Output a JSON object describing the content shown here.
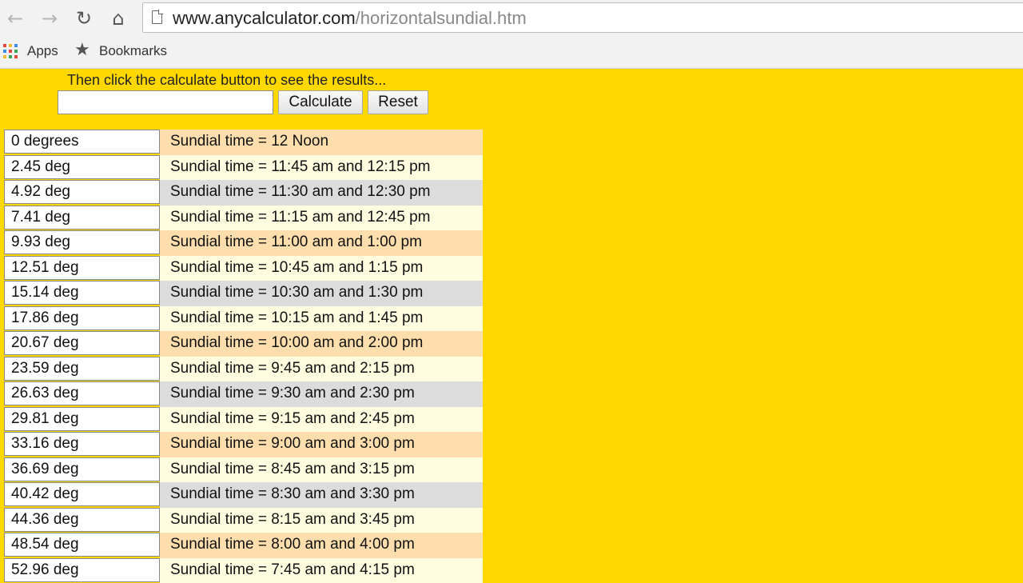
{
  "browser": {
    "url_domain": "www.anycalculator.com",
    "url_path": "/horizontalsundial.htm",
    "bookmarks": {
      "apps_label": "Apps",
      "bookmarks_label": "Bookmarks"
    }
  },
  "form": {
    "instruction": "Then click the calculate button to see the results...",
    "input_value": "",
    "calculate_label": "Calculate",
    "reset_label": "Reset"
  },
  "colors": {
    "page_background": "#ffd800",
    "row_peach": "#ffdead",
    "row_cream": "#fffde0",
    "row_gray": "#dcdcdc"
  },
  "table": {
    "rows": [
      {
        "deg": "0 degrees",
        "time": "Sundial time = 12 Noon",
        "shade": "peach"
      },
      {
        "deg": "2.45 deg",
        "time": "Sundial time = 11:45 am and 12:15 pm",
        "shade": "cream"
      },
      {
        "deg": "4.92 deg",
        "time": "Sundial time = 11:30 am and 12:30 pm",
        "shade": "gray"
      },
      {
        "deg": "7.41 deg",
        "time": "Sundial time = 11:15 am and 12:45 pm",
        "shade": "cream"
      },
      {
        "deg": "9.93 deg",
        "time": "Sundial time = 11:00 am and 1:00 pm",
        "shade": "peach"
      },
      {
        "deg": "12.51 deg",
        "time": "Sundial time = 10:45 am and 1:15 pm",
        "shade": "cream"
      },
      {
        "deg": "15.14 deg",
        "time": "Sundial time = 10:30 am and 1:30 pm",
        "shade": "gray"
      },
      {
        "deg": "17.86 deg",
        "time": "Sundial time = 10:15 am and 1:45 pm",
        "shade": "cream"
      },
      {
        "deg": "20.67 deg",
        "time": "Sundial time = 10:00 am and 2:00 pm",
        "shade": "peach"
      },
      {
        "deg": "23.59 deg",
        "time": "Sundial time = 9:45 am and 2:15 pm",
        "shade": "cream"
      },
      {
        "deg": "26.63 deg",
        "time": "Sundial time = 9:30 am and 2:30 pm",
        "shade": "gray"
      },
      {
        "deg": "29.81 deg",
        "time": "Sundial time = 9:15 am and 2:45 pm",
        "shade": "cream"
      },
      {
        "deg": "33.16 deg",
        "time": "Sundial time = 9:00 am and 3:00 pm",
        "shade": "peach"
      },
      {
        "deg": "36.69 deg",
        "time": "Sundial time = 8:45 am and 3:15 pm",
        "shade": "cream"
      },
      {
        "deg": "40.42 deg",
        "time": "Sundial time = 8:30 am and 3:30 pm",
        "shade": "gray"
      },
      {
        "deg": "44.36 deg",
        "time": "Sundial time = 8:15 am and 3:45 pm",
        "shade": "cream"
      },
      {
        "deg": "48.54 deg",
        "time": "Sundial time = 8:00 am and 4:00 pm",
        "shade": "peach"
      },
      {
        "deg": "52.96 deg",
        "time": "Sundial time = 7:45 am and 4:15 pm",
        "shade": "cream"
      }
    ]
  }
}
